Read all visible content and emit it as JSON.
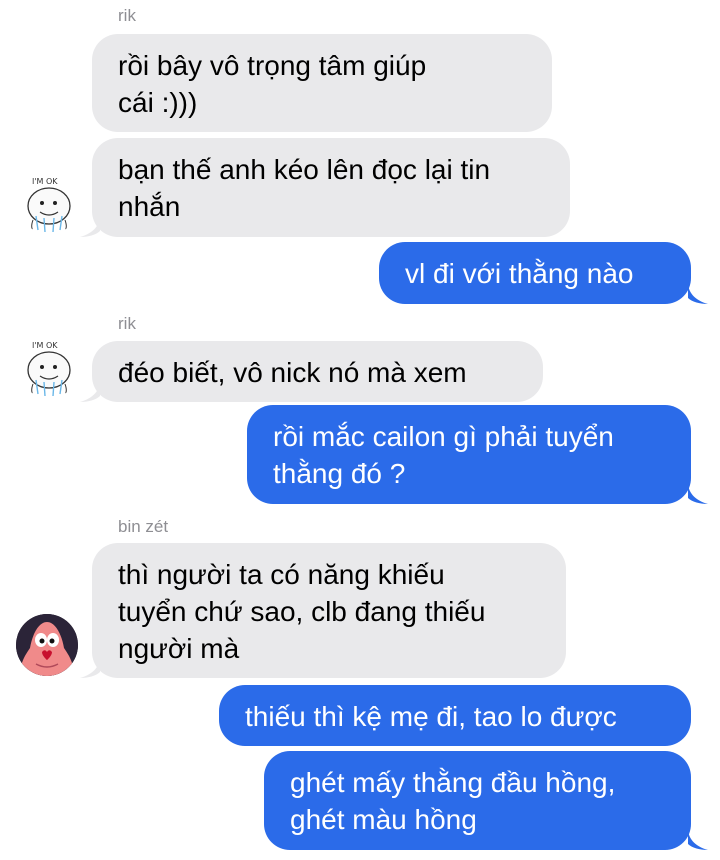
{
  "conversation": {
    "messages": [
      {
        "sender": "rik",
        "text": "rồi bây vô trọng tâm giúp\ncái :)))",
        "direction": "incoming"
      },
      {
        "text": "bạn thế anh kéo lên đọc lại tin\nnhắn",
        "direction": "incoming"
      },
      {
        "text": "vl đi với thằng nào",
        "direction": "outgoing"
      },
      {
        "sender": "rik",
        "text": "đéo biết, vô nick nó mà xem",
        "direction": "incoming"
      },
      {
        "text": "rồi mắc cailon gì phải tuyển\nthằng đó ?",
        "direction": "outgoing"
      },
      {
        "sender": "bin zét",
        "text": "thì người ta có năng khiếu\ntuyển chứ sao, clb đang thiếu\nngười mà",
        "direction": "incoming"
      },
      {
        "text": "thiếu thì kệ mẹ đi, tao lo được",
        "direction": "outgoing"
      },
      {
        "text": "ghét mấy thằng đầu hồng,\nghét màu hồng",
        "direction": "outgoing"
      }
    ],
    "avatars": {
      "rik_sticker_text": "I'M OK"
    }
  },
  "colors": {
    "incoming_bubble": "#e9e9eb",
    "outgoing_bubble": "#2b6be9",
    "sender_label": "#8e8e93"
  }
}
